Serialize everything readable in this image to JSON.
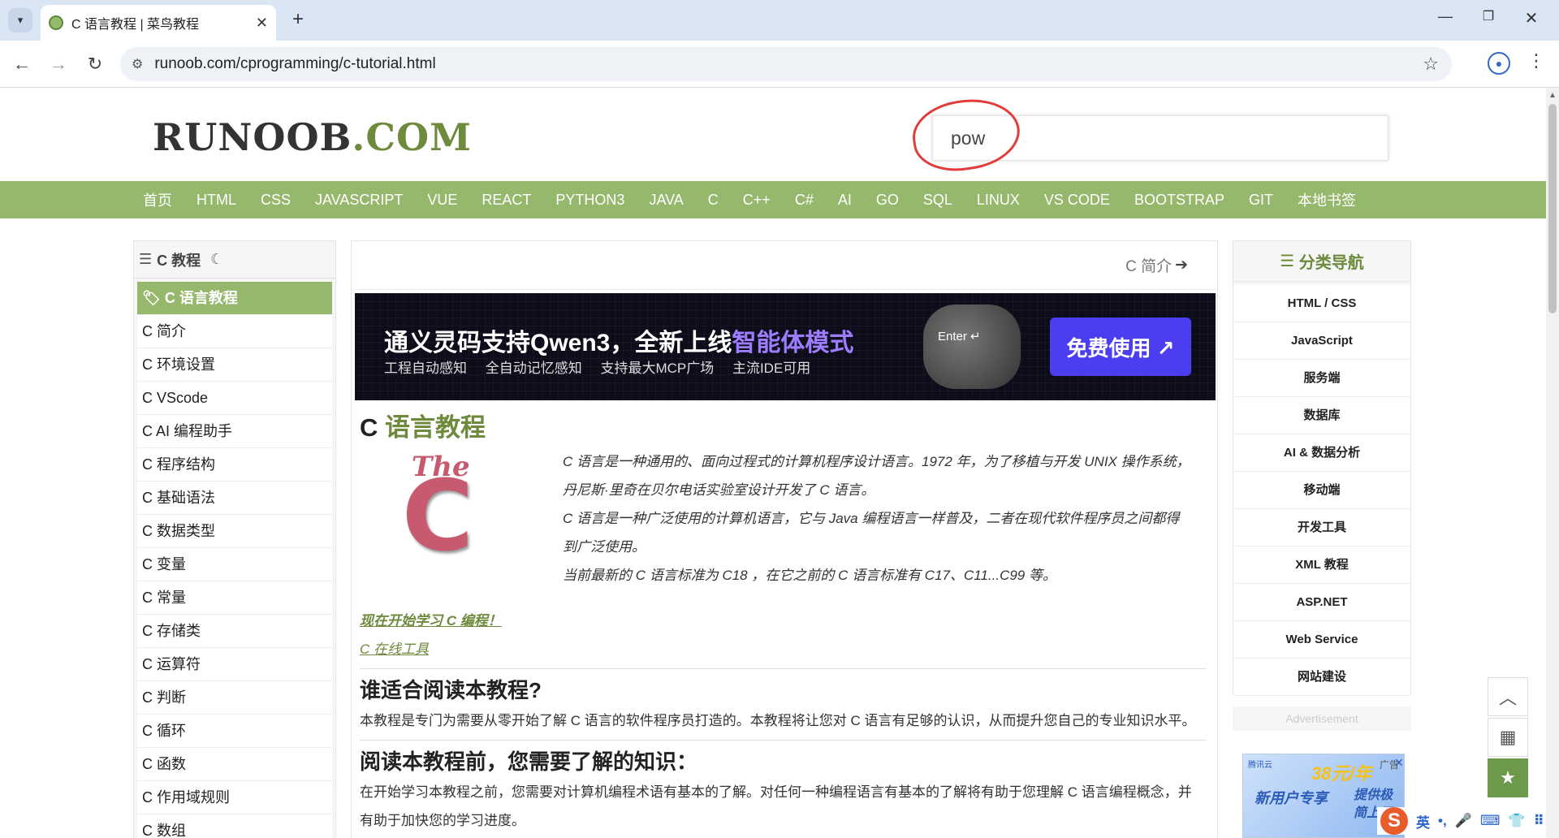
{
  "browser": {
    "tab_title": "C 语言教程 | 菜鸟教程",
    "url": "runoob.com/cprogramming/c-tutorial.html"
  },
  "site": {
    "logo_main": "RUNOOB",
    "logo_suffix": ".COM",
    "search_value": "pow"
  },
  "menu": [
    "首页",
    "HTML",
    "CSS",
    "JAVASCRIPT",
    "VUE",
    "REACT",
    "PYTHON3",
    "JAVA",
    "C",
    "C++",
    "C#",
    "AI",
    "GO",
    "SQL",
    "LINUX",
    "VS CODE",
    "BOOTSTRAP",
    "GIT",
    "本地书签"
  ],
  "leftnav": {
    "title": "C 教程",
    "active": "C 语言教程",
    "items": [
      "C 简介",
      "C 环境设置",
      "C VScode",
      "C AI 编程助手",
      "C 程序结构",
      "C 基础语法",
      "C 数据类型",
      "C 变量",
      "C 常量",
      "C 存储类",
      "C 运算符",
      "C 判断",
      "C 循环",
      "C 函数",
      "C 作用域规则",
      "C 数组"
    ]
  },
  "main": {
    "next_link": "C 简介",
    "banner": {
      "title_prefix": "通义灵码支持Qwen3，全新上线",
      "title_highlight": "智能体模式",
      "subtitle": "工程自动感知 全自动记忆感知 支持最大MCP广场 主流IDE可用",
      "robot_label": "Enter ↵",
      "cta": "免费使用 ↗"
    },
    "heading_prefix": "C ",
    "heading_highlight": "语言教程",
    "logo_the": "The",
    "logo_c": "C",
    "intro_lines": [
      "C 语言是一种通用的、面向过程式的计算机程序设计语言。1972 年，为了移植与开发 UNIX 操作系统，",
      "丹尼斯·里奇在贝尔电话实验室设计开发了 C 语言。",
      "C 语言是一种广泛使用的计算机语言，它与 Java 编程语言一样普及，二者在现代软件程序员之间都得",
      "到广泛使用。",
      "当前最新的 C 语言标准为 C18 ，在它之前的 C 语言标准有 C17、C11...C99 等。"
    ],
    "link_start": "现在开始学习 C 编程！",
    "link_tool": "C 在线工具",
    "section1_title": "谁适合阅读本教程?",
    "section1_text": "本教程是专门为需要从零开始了解 C 语言的软件程序员打造的。本教程将让您对 C 语言有足够的认识，从而提升您自己的专业知识水平。",
    "section2_title": "阅读本教程前，您需要了解的知识：",
    "section2_text": "在开始学习本教程之前，您需要对计算机编程术语有基本的了解。对任何一种编程语言有基本的了解将有助于您理解 C 语言编程概念，并有助于加快您的学习进度。"
  },
  "rightnav": {
    "title": "分类导航",
    "items": [
      "HTML / CSS",
      "JavaScript",
      "服务端",
      "数据库",
      "AI & 数据分析",
      "移动端",
      "开发工具",
      "XML 教程",
      "ASP.NET",
      "Web Service",
      "网站建设"
    ]
  },
  "ad": {
    "label": "Advertisement",
    "brand": "腾讯云",
    "price": "38元/年",
    "text1": "新用户专享",
    "text2": "提供极简上云",
    "tag": "广告",
    "close": "✕"
  },
  "ime": {
    "logo": "S",
    "lang": "英",
    "punct": "•,",
    "mic": "🎤",
    "keyboard": "⌨",
    "shirt": "👕",
    "grid": "⠿"
  }
}
